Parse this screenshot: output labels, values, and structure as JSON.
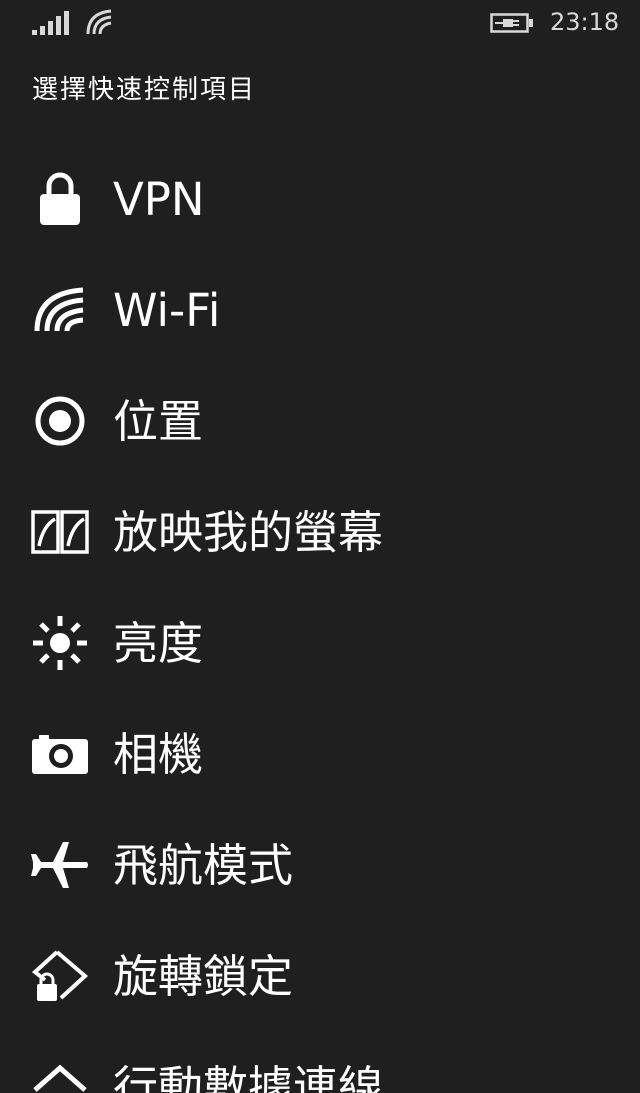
{
  "status_bar": {
    "time": "23:18",
    "signal_icon": "cell-signal-icon",
    "wifi_icon": "wifi-icon",
    "battery_icon": "battery-charging-icon"
  },
  "page": {
    "title": "選擇快速控制項目"
  },
  "options": [
    {
      "label": "VPN",
      "icon": "lock-icon"
    },
    {
      "label": "Wi-Fi",
      "icon": "wifi-icon"
    },
    {
      "label": "位置",
      "icon": "location-icon"
    },
    {
      "label": "放映我的螢幕",
      "icon": "project-screen-icon"
    },
    {
      "label": "亮度",
      "icon": "brightness-icon"
    },
    {
      "label": "相機",
      "icon": "camera-icon"
    },
    {
      "label": "飛航模式",
      "icon": "airplane-icon"
    },
    {
      "label": "旋轉鎖定",
      "icon": "rotation-lock-icon"
    },
    {
      "label": "行動數據連線",
      "icon": "mobile-data-icon"
    }
  ],
  "colors": {
    "background": "#1f1f1f",
    "foreground": "#ffffff"
  }
}
